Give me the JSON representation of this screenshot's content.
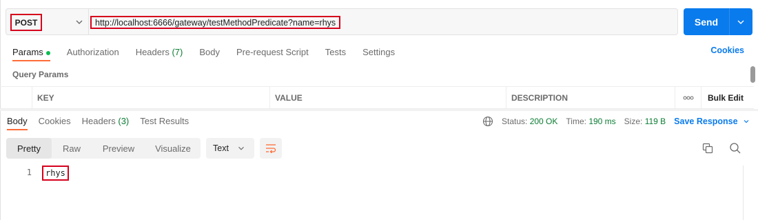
{
  "request": {
    "method": "POST",
    "url": "http://localhost:6666/gateway/testMethodPredicate?name=rhys",
    "send_label": "Send"
  },
  "request_tabs": [
    {
      "label": "Params",
      "active": true
    },
    {
      "label": "Authorization"
    },
    {
      "label": "Headers",
      "count": "(7)"
    },
    {
      "label": "Body"
    },
    {
      "label": "Pre-request Script"
    },
    {
      "label": "Tests"
    },
    {
      "label": "Settings"
    }
  ],
  "cookies_link": "Cookies",
  "query_params": {
    "title": "Query Params",
    "columns": {
      "key": "KEY",
      "value": "VALUE",
      "description": "DESCRIPTION",
      "more": "ooo",
      "bulk_edit": "Bulk Edit"
    }
  },
  "response_tabs": [
    {
      "label": "Body",
      "active": true
    },
    {
      "label": "Cookies"
    },
    {
      "label": "Headers",
      "count": "(3)"
    },
    {
      "label": "Test Results"
    }
  ],
  "response_meta": {
    "status_label": "Status:",
    "status_value": "200 OK",
    "time_label": "Time:",
    "time_value": "190 ms",
    "size_label": "Size:",
    "size_value": "119 B",
    "save_response": "Save Response"
  },
  "view_modes": [
    "Pretty",
    "Raw",
    "Preview",
    "Visualize"
  ],
  "format": "Text",
  "response_body": {
    "line_number": "1",
    "content": "rhys"
  },
  "colors": {
    "accent": "#097bed",
    "tab_indicator": "#ff6c37",
    "success": "#0a7c32",
    "highlight_box": "#d6001c"
  }
}
